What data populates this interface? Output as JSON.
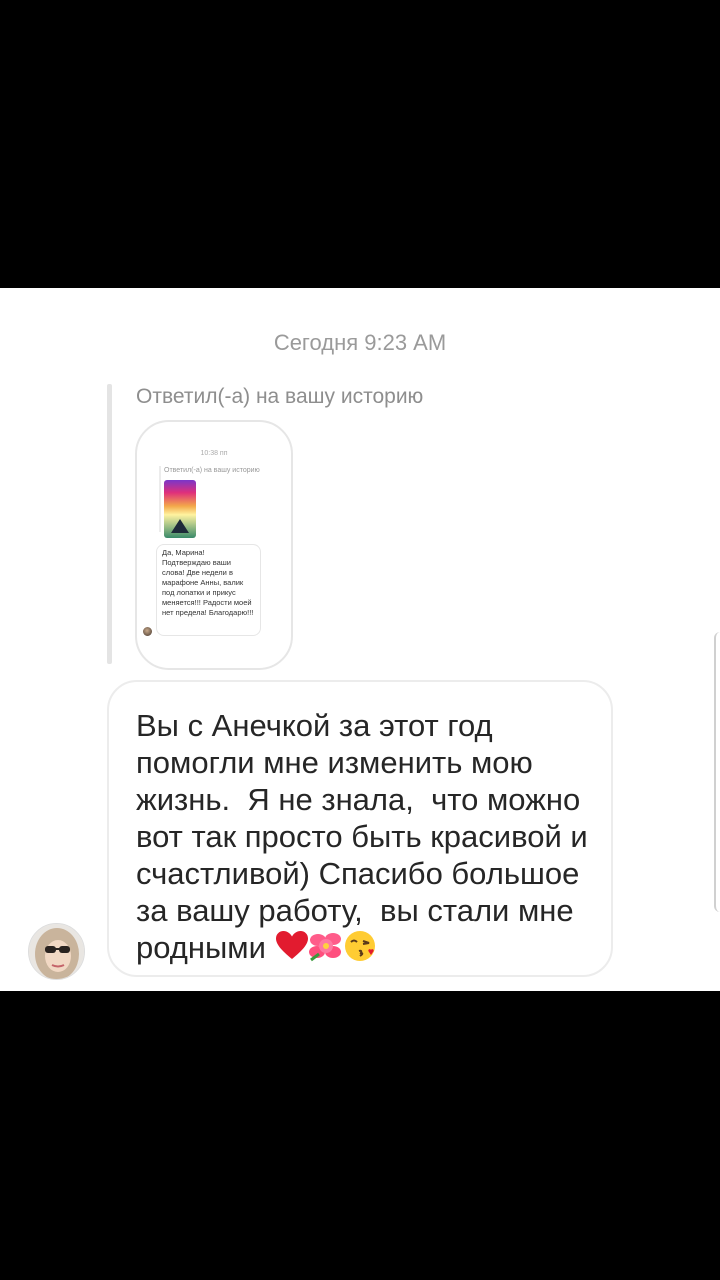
{
  "timestamp": "Сегодня 9:23 AM",
  "story_reply": {
    "label": "Ответил(-а) на вашу историю",
    "preview": {
      "time": "10:38 пп",
      "reply_label": "Ответил(-а) на вашу историю",
      "message": "Да, Марина! Подтверждаю ваши слова! Две недели в марафоне Анны, валик под лопатки и прикус меняется!!! Радости моей нет предела! Благодарю!!!"
    }
  },
  "message": {
    "text": "Вы с Анечкой за этот год помогли мне изменить мою жизнь.  Я не знала,  что можно вот так просто быть красивой и счастливой) Спасибо большое за вашу работу,  вы стали мне родными",
    "emojis": [
      "heart-emoji",
      "hibiscus-emoji",
      "kissing-face-emoji"
    ]
  },
  "colors": {
    "background": "#000000",
    "panel": "#ffffff",
    "timestamp": "#9a9a9a",
    "message_text": "#262626",
    "heart": "#e21b2f"
  }
}
